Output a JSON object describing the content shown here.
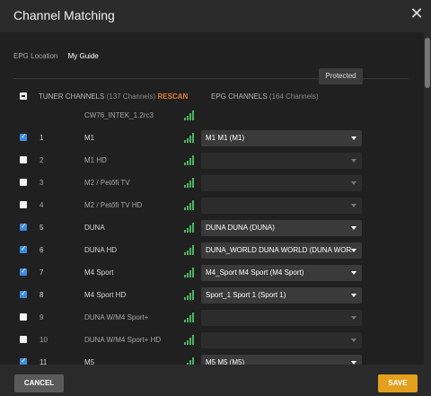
{
  "dialog": {
    "title": "Channel Matching"
  },
  "tabs": [
    {
      "label": "EPG Location"
    },
    {
      "label": "My Guide"
    }
  ],
  "columns": {
    "tuner_title": "TUNER CHANNELS",
    "tuner_count": "(137 Channels)",
    "rescan": "RESCAN",
    "epg_title": "EPG CHANNELS",
    "epg_count": "(164 Channels)"
  },
  "protected_label": "Protected",
  "rows": [
    {
      "num": "",
      "name": "CW76_INTEK_1.2rc3",
      "checked": null,
      "epg": ""
    },
    {
      "num": "1",
      "name": "M1",
      "checked": true,
      "epg": "M1 M1 (M1)"
    },
    {
      "num": "2",
      "name": "M1 HD",
      "checked": false,
      "epg": ""
    },
    {
      "num": "3",
      "name": "M2 / Petőfi TV",
      "checked": false,
      "epg": ""
    },
    {
      "num": "4",
      "name": "M2 / Petőfi TV HD",
      "checked": false,
      "epg": ""
    },
    {
      "num": "5",
      "name": "DUNA",
      "checked": true,
      "epg": "DUNA DUNA (DUNA)"
    },
    {
      "num": "6",
      "name": "DUNA HD",
      "checked": true,
      "epg": "DUNA_WORLD DUNA WORLD (DUNA WORLD)"
    },
    {
      "num": "7",
      "name": "M4 Sport",
      "checked": true,
      "epg": "M4_Sport M4 Sport (M4 Sport)"
    },
    {
      "num": "8",
      "name": "M4 Sport HD",
      "checked": true,
      "epg": "Sport_1 Sport 1 (Sport 1)"
    },
    {
      "num": "9",
      "name": "DUNA W/M4 Sport+",
      "checked": false,
      "epg": ""
    },
    {
      "num": "10",
      "name": "DUNA W/M4 Sport+ HD",
      "checked": false,
      "epg": ""
    },
    {
      "num": "11",
      "name": "M5",
      "checked": true,
      "epg": "M5 M5 (M5)"
    }
  ],
  "footer": {
    "cancel": "CANCEL",
    "save": "SAVE"
  }
}
